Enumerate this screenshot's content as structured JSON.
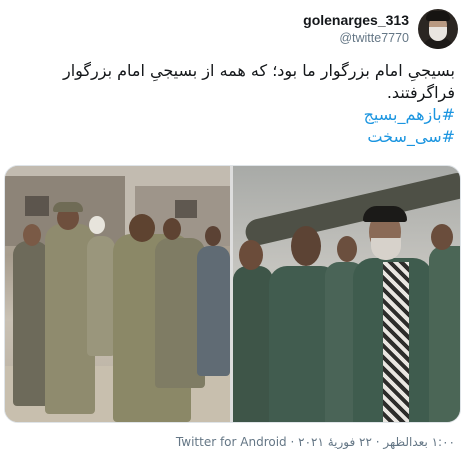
{
  "tweet": {
    "author": {
      "display_name": "golenarges_313",
      "handle": "@twitte7770"
    },
    "text_line_1": "بسیجیِ امام بزرگوار ما بود؛ که همه از بسیجیِ امام بزرگوار",
    "text_line_2": "فراگرفتند.",
    "hashtags": [
      "#بازهم_بسیج",
      "#سی_سخت"
    ],
    "timestamp_line": "١:٠٠ بعدالظهر · ٢٢ فوریهٔ ٢٠٢١ · Twitter for Android"
  },
  "colors": {
    "link": "#1b95e0",
    "text_primary": "#14171a",
    "text_secondary": "#657786",
    "border": "#dfe4e8"
  },
  "icons": {
    "avatar": "profile-photo"
  }
}
